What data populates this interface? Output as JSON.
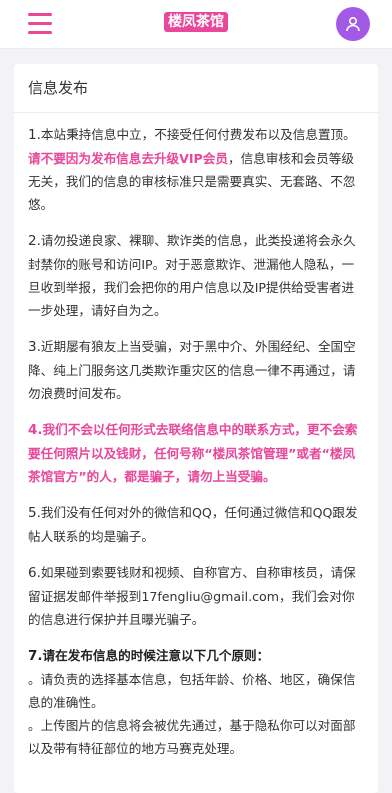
{
  "header": {
    "brand": "楼凤茶馆",
    "menu_icon": "hamburger-menu-icon",
    "user_icon": "user-icon",
    "accent": "#e8479a",
    "avatar_color": "#a259e6"
  },
  "card": {
    "title": "信息发布",
    "p1_num": "1.",
    "p1_a": "本站秉持信息中立，不接受任何付费发布以及信息置顶。",
    "p1_b": "请不要因为发布信息去升级VIP会员",
    "p1_c": "，信息审核和会员等级无关，我们的信息的审核标准只是需要真实、无套路、不忽悠。",
    "p2_num": "2.",
    "p2": "请勿投递良家、裸聊、欺诈类的信息，此类投递将会永久封禁你的账号和访问IP。对于恶意欺诈、泄漏他人隐私，一旦收到举报，我们会把你的用户信息以及IP提供给受害者进一步处理，请好自为之。",
    "p3_num": "3.",
    "p3": "近期屡有狼友上当受骗，对于黑中介、外围经纪、全国空降、纯上门服务这几类欺诈重灾区的信息一律不再通过，请勿浪费时间发布。",
    "p4_num": "4.",
    "p4": "我们不会以任何形式去联络信息中的联系方式，更不会索要任何照片以及钱财，任何号称“楼凤茶馆管理”或者“楼凤茶馆官方”的人，都是骗子，请勿上当受骗。",
    "p5_num": "5.",
    "p5": "我们没有任何对外的微信和QQ，任何通过微信和QQ跟发帖人联系的均是骗子。",
    "p6_num": "6.",
    "p6": "如果碰到索要钱财和视频、自称官方、自称审核员，请保留证据发邮件举报到17fengliu@gmail.com，我们会对你的信息进行保护并且曝光骗子。",
    "p7_num": "7.",
    "p7_title": "请在发布信息的时候注意以下几个原则：",
    "p7_items": [
      "。请负责的选择基本信息，包括年龄、价格、地区，确保信息的准确性。",
      "。上传图片的信息将会被优先通过，基于隐私你可以对面部以及带有特征部位的地方马赛克处理。"
    ]
  }
}
